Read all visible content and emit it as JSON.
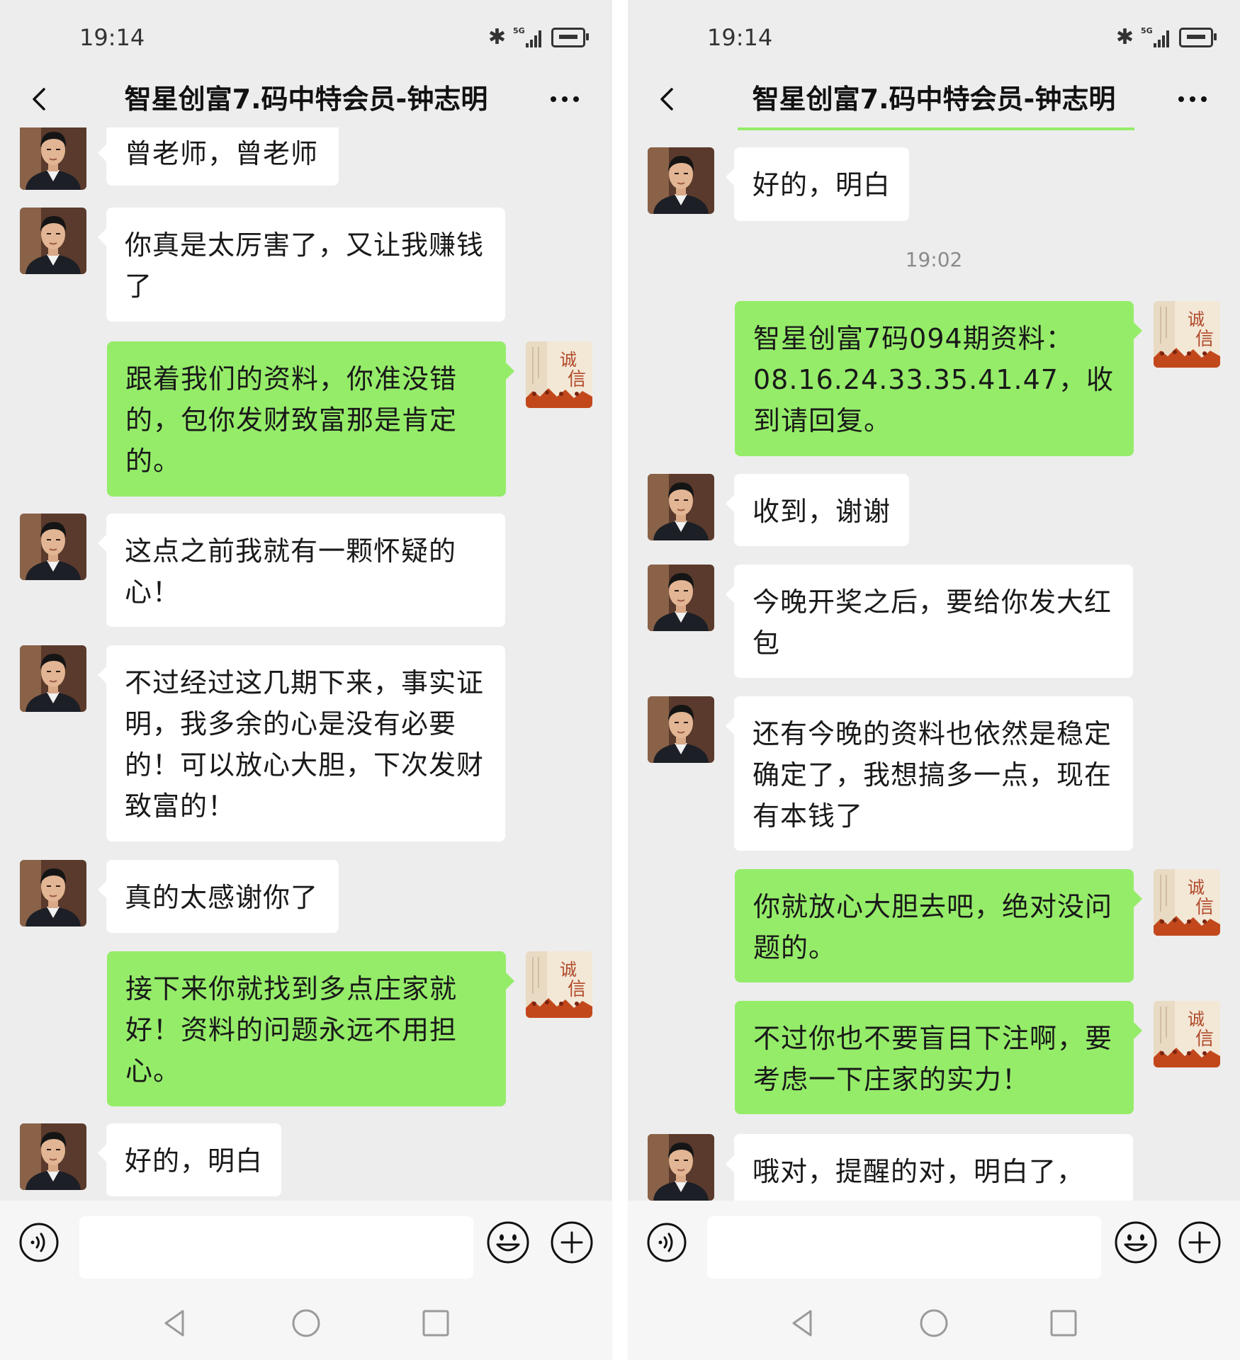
{
  "status_bar": {
    "time": "19:14",
    "network": "5G"
  },
  "chat": {
    "title": "智星创富7.码中特会员-钟志明"
  },
  "colors": {
    "background": "#ededed",
    "sent_bubble": "#95ec69",
    "received_bubble": "#ffffff"
  },
  "icons": {
    "back": "chevron-left-icon",
    "more": "more-dots-icon",
    "voice": "voice-icon",
    "emoji": "emoji-icon",
    "plus": "plus-icon",
    "contact_avatar": "man-portrait-avatar",
    "self_avatar": "chengxin-calligraphy-avatar",
    "sys_back": "triangle-back-icon",
    "sys_home": "circle-home-icon",
    "sys_recent": "square-recents-icon"
  },
  "self_avatar_text": "诚信",
  "left_screen": {
    "messages": [
      {
        "side": "received",
        "text": "曾老师，曾老师"
      },
      {
        "side": "received",
        "text": "你真是太厉害了，又让我赚钱了"
      },
      {
        "side": "sent",
        "text": "跟着我们的资料，你准没错的，包你发财致富那是肯定的。"
      },
      {
        "side": "received",
        "text": "这点之前我就有一颗怀疑的心！"
      },
      {
        "side": "received",
        "text": "不过经过这几期下来，事实证明，我多余的心是没有必要的！可以放心大胆，下次发财致富的！"
      },
      {
        "side": "received",
        "text": "真的太感谢你了"
      },
      {
        "side": "sent",
        "text": "接下来你就找到多点庄家就好！资料的问题永远不用担心。"
      },
      {
        "side": "received",
        "text": "好的，明白"
      }
    ]
  },
  "right_screen": {
    "timestamp": "19:02",
    "messages": [
      {
        "side": "received",
        "text": "好的，明白"
      },
      {
        "side": "sent",
        "text": "智星创富7码094期资料：08.16.24.33.35.41.47，收到请回复。"
      },
      {
        "side": "received",
        "text": "收到，谢谢"
      },
      {
        "side": "received",
        "text": "今晚开奖之后，要给你发大红包"
      },
      {
        "side": "received",
        "text": "还有今晚的资料也依然是稳定确定了，我想搞多一点，现在有本钱了"
      },
      {
        "side": "sent",
        "text": "你就放心大胆去吧，绝对没问题的。"
      },
      {
        "side": "sent",
        "text": "不过你也不要盲目下注啊，要考虑一下庄家的实力！"
      },
      {
        "side": "received",
        "text": "哦对，提醒的对，明白了，"
      }
    ]
  }
}
